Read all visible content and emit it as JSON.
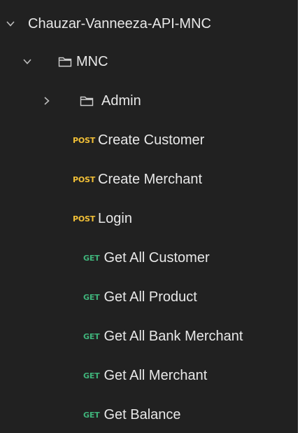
{
  "collection": {
    "name": "Chauzar-Vanneeza-API-MNC",
    "icon": "chevron-down-icon"
  },
  "folders": {
    "mnc": {
      "name": "MNC",
      "chevron": "chevron-down-icon",
      "icon": "folder-icon"
    },
    "admin": {
      "name": "Admin",
      "chevron": "chevron-right-icon",
      "icon": "folder-icon"
    }
  },
  "requests": [
    {
      "method": "POST",
      "name": "Create Customer"
    },
    {
      "method": "POST",
      "name": "Create Merchant"
    },
    {
      "method": "POST",
      "name": "Login"
    },
    {
      "method": "GET",
      "name": "Get All Customer"
    },
    {
      "method": "GET",
      "name": "Get All Product"
    },
    {
      "method": "GET",
      "name": "Get All Bank Merchant"
    },
    {
      "method": "GET",
      "name": "Get All Merchant"
    },
    {
      "method": "GET",
      "name": "Get Balance"
    }
  ],
  "colors": {
    "background": "#212121",
    "text": "#e8e8e8",
    "post": "#f2c037",
    "get": "#3fb37a"
  }
}
